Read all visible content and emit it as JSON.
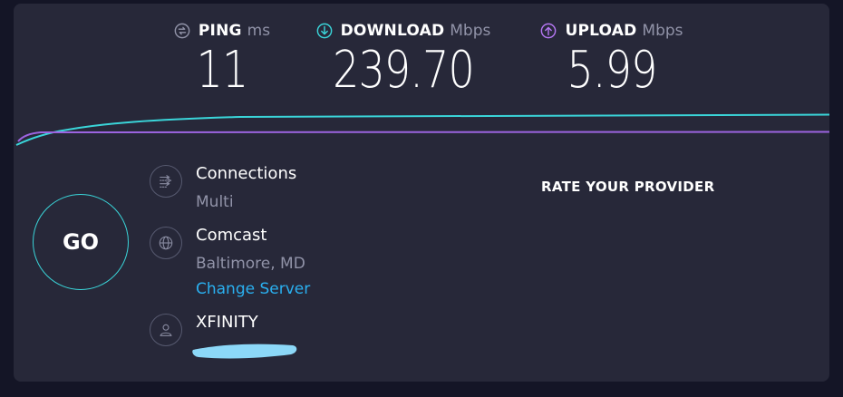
{
  "metrics": {
    "ping": {
      "label": "PING",
      "unit": "ms",
      "value": "11",
      "icon": "ping-icon",
      "color": "#9193a8"
    },
    "download": {
      "label": "DOWNLOAD",
      "unit": "Mbps",
      "value": "239.70",
      "icon": "download-arrow-icon",
      "color": "#3ad5d9"
    },
    "upload": {
      "label": "UPLOAD",
      "unit": "Mbps",
      "value": "5.99",
      "icon": "upload-arrow-icon",
      "color": "#b577f3"
    }
  },
  "graph": {
    "download_color": "#3ad5d9",
    "upload_color": "#9c64e0"
  },
  "go_button": {
    "label": "GO"
  },
  "connections": {
    "title": "Connections",
    "value": "Multi",
    "icon": "connections-icon"
  },
  "server": {
    "title": "Comcast",
    "location": "Baltimore, MD",
    "change_link": "Change Server",
    "icon": "globe-icon"
  },
  "provider": {
    "name": "XFINITY",
    "icon": "user-icon"
  },
  "rate_provider": {
    "label": "RATE YOUR PROVIDER"
  },
  "colors": {
    "background": "#141526",
    "panel": "#272839",
    "accent_download": "#3ad5d9",
    "accent_upload": "#b577f3",
    "link": "#2ab0f0",
    "redaction": "#8cd8f8"
  }
}
